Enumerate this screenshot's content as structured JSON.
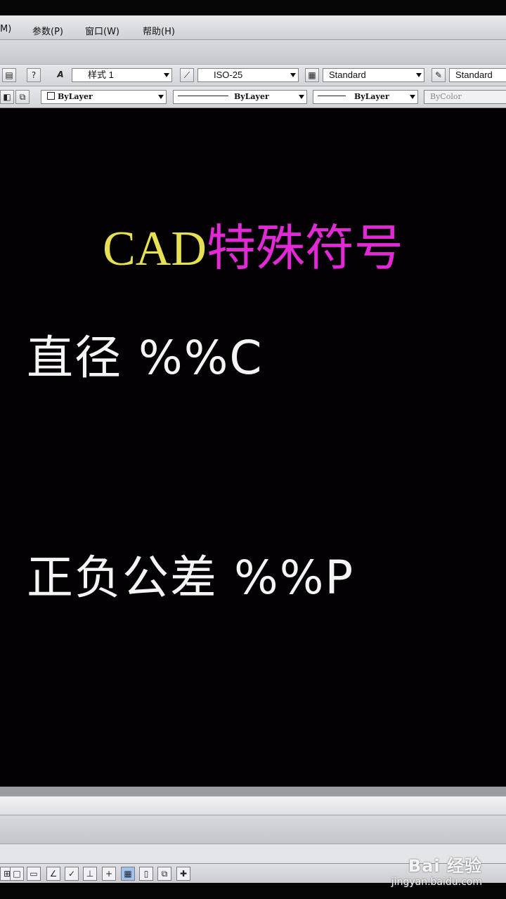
{
  "menu": {
    "items": [
      "M)",
      "参数(P)",
      "窗口(W)",
      "帮助(H)"
    ]
  },
  "toolbar1": {
    "text_style": "样式 1",
    "dim_style": "ISO-25",
    "table_style": "Standard",
    "multileader_style": "Standard"
  },
  "toolbar2": {
    "layer_color": "ByLayer",
    "linetype": "ByLayer",
    "lineweight": "ByLayer",
    "plot_style": "ByColor"
  },
  "drawing": {
    "title_prefix": "CAD",
    "title_main": "特殊符号",
    "line1": "直径 %%C",
    "line2": "正负公差 %%P",
    "colors": {
      "prefix": "#e6e052",
      "main": "#e129d6",
      "text": "#f4f4f4"
    }
  },
  "watermark": {
    "brand": "Bai 经验",
    "url": "jingyan.baidu.com"
  }
}
